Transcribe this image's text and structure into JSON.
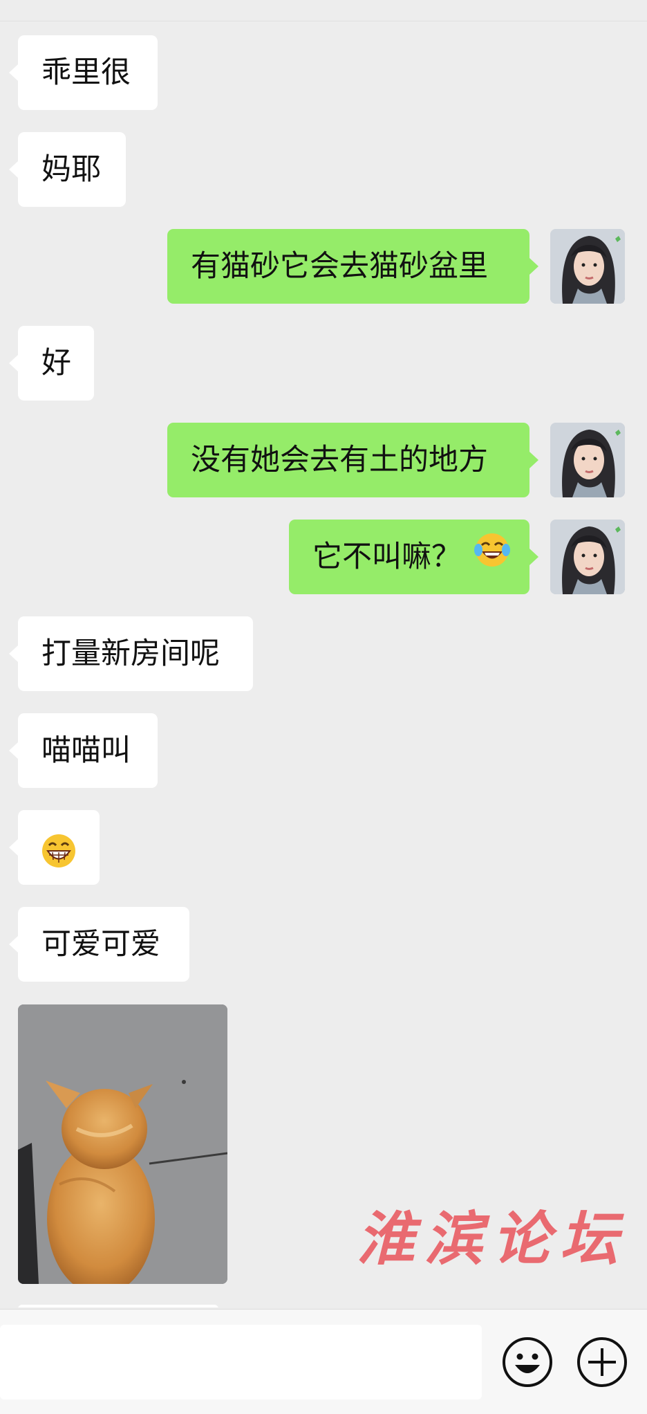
{
  "messages": [
    {
      "side": "recv",
      "text": "乖里很"
    },
    {
      "side": "recv",
      "text": "妈耶"
    },
    {
      "side": "sent",
      "text": "有猫砂它会去猫砂盆里"
    },
    {
      "side": "recv",
      "text": "好"
    },
    {
      "side": "sent",
      "text": "没有她会去有土的地方"
    },
    {
      "side": "sent",
      "text": "它不叫嘛？",
      "emoji": "tears-of-joy-emoji"
    },
    {
      "side": "recv",
      "text": "打量新房间呢"
    },
    {
      "side": "recv",
      "text": "喵喵叫"
    },
    {
      "side": "recv",
      "emoji": "grinning-emoji"
    },
    {
      "side": "recv",
      "text": "可爱可爱"
    },
    {
      "side": "recv",
      "image": "orange-kitten-photo"
    }
  ],
  "watermark": "淮滨论坛",
  "input_bar": {
    "placeholder": "",
    "icons": [
      "emoji-icon",
      "plus-icon"
    ]
  },
  "colors": {
    "background": "#ededed",
    "sent_bubble": "#95ec69",
    "recv_bubble": "#ffffff",
    "watermark": "#e9595f"
  }
}
